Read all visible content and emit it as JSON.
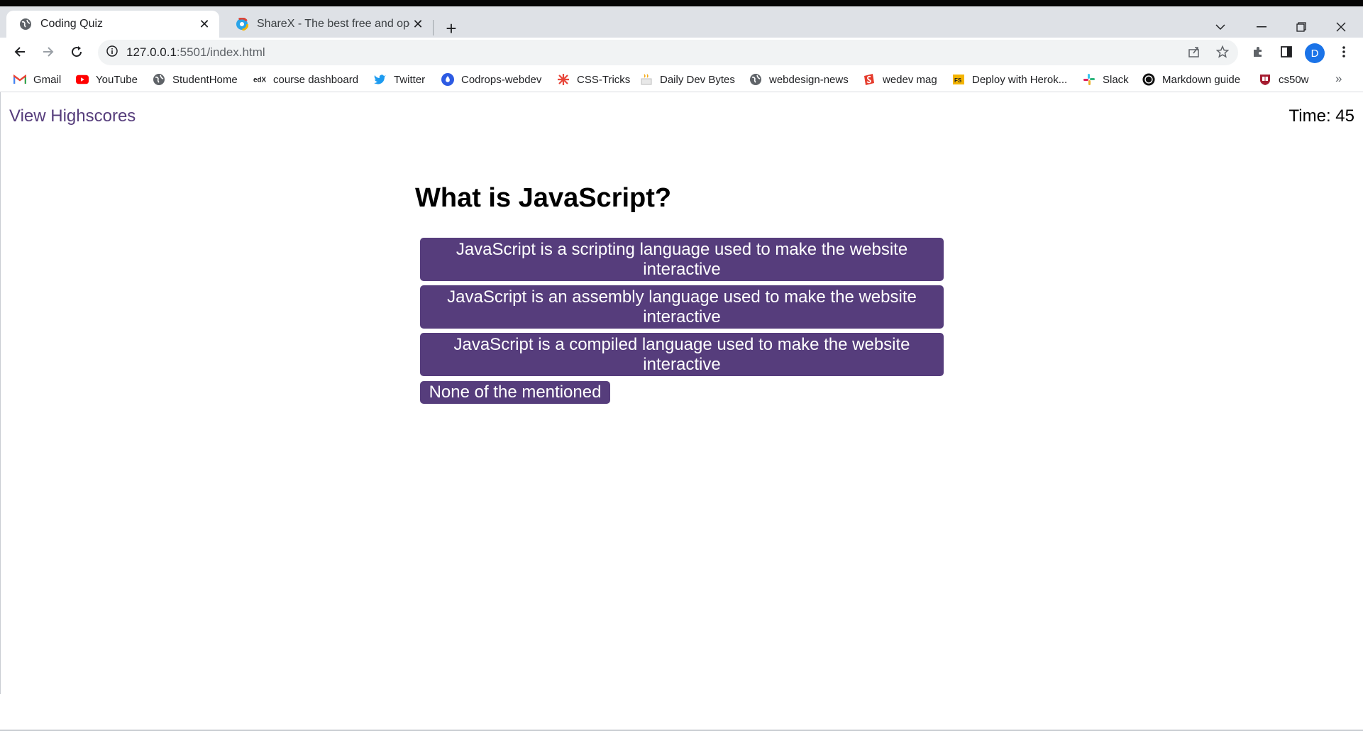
{
  "browser": {
    "tabs": [
      {
        "title": "Coding Quiz",
        "active": true
      },
      {
        "title": "ShareX - The best free and open",
        "active": false
      }
    ],
    "new_tab_label": "+",
    "window_controls": {
      "dropdown": "⌄",
      "minimize": "—",
      "restore": "❐",
      "close": "✕"
    },
    "url_host": "127.0.0.1",
    "url_rest": ":5501/index.html",
    "avatar_letter": "D",
    "bookmarks": [
      {
        "label": "Gmail",
        "icon": "gmail-icon"
      },
      {
        "label": "YouTube",
        "icon": "youtube-icon"
      },
      {
        "label": "StudentHome",
        "icon": "globe-icon"
      },
      {
        "label": "course dashboard",
        "icon": "edx-icon"
      },
      {
        "label": "Twitter",
        "icon": "twitter-icon"
      },
      {
        "label": "Codrops-webdev",
        "icon": "codrops-icon"
      },
      {
        "label": "CSS-Tricks",
        "icon": "css-tricks-icon"
      },
      {
        "label": "Daily Dev Bytes",
        "icon": "cup-icon"
      },
      {
        "label": "webdesign-news",
        "icon": "globe-icon"
      },
      {
        "label": "wedev mag",
        "icon": "smashing-icon"
      },
      {
        "label": "Deploy with Herok...",
        "icon": "fs-icon"
      },
      {
        "label": "Slack",
        "icon": "slack-icon"
      },
      {
        "label": "Markdown guide",
        "icon": "markdown-icon"
      },
      {
        "label": "cs50w",
        "icon": "harvard-icon"
      }
    ],
    "bookmarks_more": "»"
  },
  "page": {
    "highscores_link": "View Highscores",
    "timer": "Time: 45",
    "question": "What is JavaScript?",
    "answers": [
      "JavaScript is a scripting language used to make the website interactive",
      "JavaScript is an assembly language used to make the website interactive",
      "JavaScript is a compiled language used to make the website interactive",
      "None of the mentioned"
    ],
    "accent_color": "#563d7c"
  }
}
